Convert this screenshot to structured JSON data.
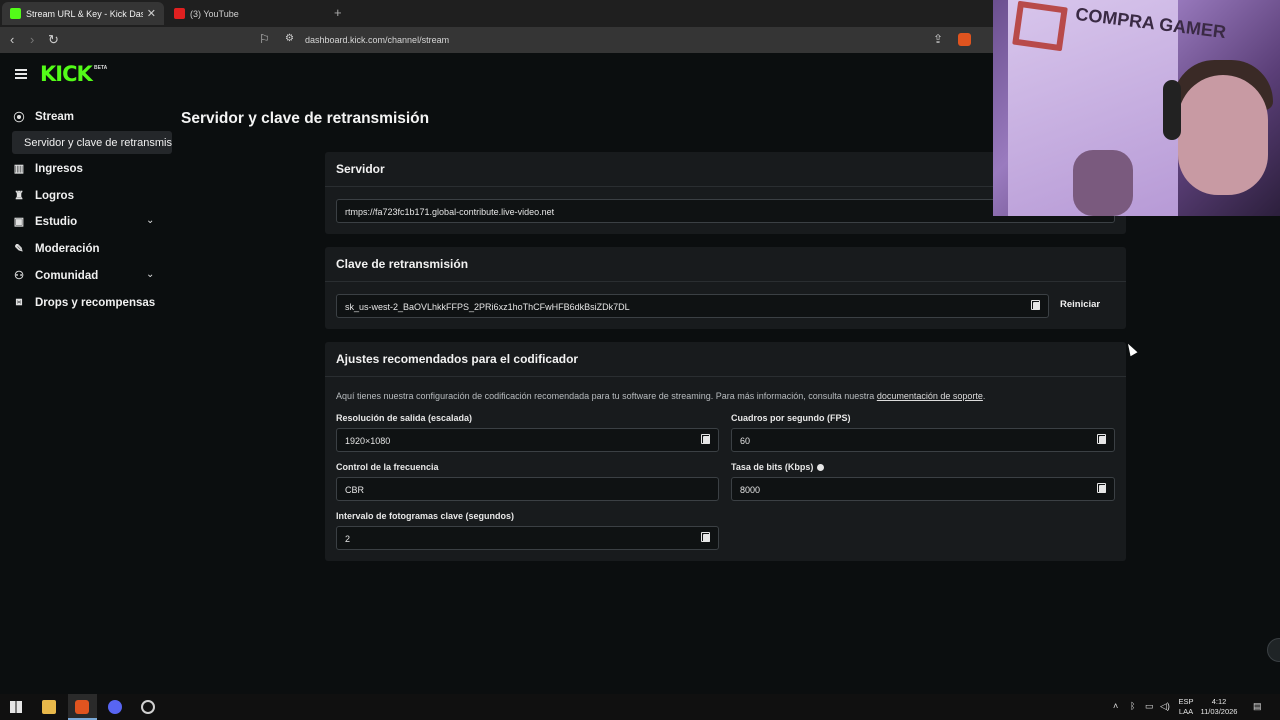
{
  "browser": {
    "tabs": [
      {
        "title": "Stream URL & Key - Kick Dashbo",
        "active": true
      },
      {
        "title": "(3) YouTube",
        "active": false
      }
    ],
    "new_tab": "+",
    "url": "dashboard.kick.com/channel/stream"
  },
  "app": {
    "logo": "KICK",
    "logo_badge": "BETA",
    "accent_color": "#53fc18"
  },
  "sidebar": {
    "items": [
      {
        "label": "Stream",
        "icon": "broadcast-icon"
      },
      {
        "label": "Servidor y clave de retransmisión",
        "icon": ""
      },
      {
        "label": "Ingresos",
        "icon": "chart-icon"
      },
      {
        "label": "Logros",
        "icon": "trophy-icon"
      },
      {
        "label": "Estudio",
        "icon": "studio-icon"
      },
      {
        "label": "Moderación",
        "icon": "wrench-icon"
      },
      {
        "label": "Comunidad",
        "icon": "people-icon"
      },
      {
        "label": "Drops y recompensas",
        "icon": "gift-icon"
      }
    ]
  },
  "page": {
    "title": "Servidor y clave de retransmisión"
  },
  "server_card": {
    "title": "Servidor",
    "value": "rtmps://fa723fc1b171.global-contribute.live-video.net"
  },
  "key_card": {
    "title": "Clave de retransmisión",
    "value": "sk_us-west-2_BaOVLhkkFFPS_2PRi6xz1hoThCFwHFB6dkBsiZDk7DL",
    "reset_label": "Reiniciar"
  },
  "encoder_card": {
    "title": "Ajustes recomendados para el codificador",
    "description": "Aquí tienes nuestra configuración de codificación recomendada para tu software de streaming. Para más información, consulta nuestra ",
    "doc_link": "documentación de soporte",
    "description_end": ".",
    "fields": {
      "resolution_label": "Resolución de salida (escalada)",
      "resolution_value": "1920×1080",
      "fps_label": "Cuadros por segundo (FPS)",
      "fps_value": "60",
      "rate_control_label": "Control de la frecuencia",
      "rate_control_value": "CBR",
      "bitrate_label": "Tasa de bits (Kbps)",
      "bitrate_value": "8000",
      "keyframe_label": "Intervalo de fotogramas clave (segundos)",
      "keyframe_value": "2"
    }
  },
  "webcam": {
    "shirt_text": "COMPRA GAMER"
  },
  "taskbar": {
    "lang_top": "ESP",
    "lang_bottom": "LAA",
    "time": "4:12",
    "date": "11/03/2026"
  }
}
